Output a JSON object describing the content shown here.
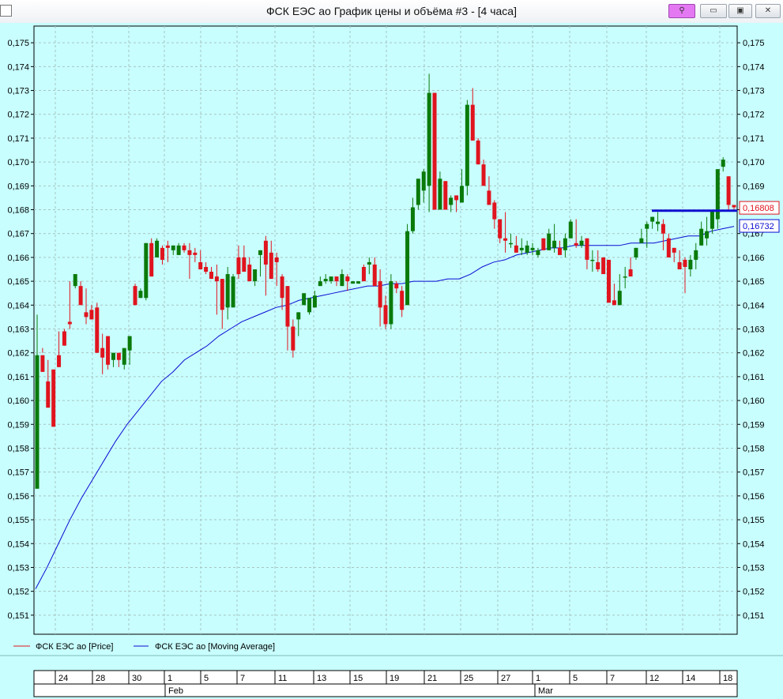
{
  "window": {
    "title": "ФСК ЕЭС ао График цены и объёма #3 - [4 часа]",
    "buttons": {
      "pin": "⚲",
      "minimize": "▭",
      "maximize": "▣",
      "close": "✕"
    }
  },
  "colors": {
    "background": "#c8fefe",
    "up": "#0a7a0a",
    "down": "#e0141e",
    "ma": "#0a0ad2",
    "grid": "#a8c4c4"
  },
  "chart_data": {
    "type": "candlestick",
    "ylim": [
      0.1502,
      0.1757
    ],
    "yticks": [
      "0,151",
      "0,152",
      "0,153",
      "0,154",
      "0,155",
      "0,156",
      "0,157",
      "0,158",
      "0,159",
      "0,160",
      "0,161",
      "0,162",
      "0,163",
      "0,164",
      "0,165",
      "0,166",
      "0,167",
      "0,168",
      "0,169",
      "0,170",
      "0,171",
      "0,172",
      "0,173",
      "0,174",
      "0,175"
    ],
    "xlabels": [
      "24",
      "28",
      "30",
      "1",
      "5",
      "7",
      "11",
      "13",
      "15",
      "19",
      "21",
      "25",
      "27",
      "1",
      "5",
      "7",
      "12",
      "14",
      "18"
    ],
    "months": [
      "Feb",
      "Mar"
    ],
    "candles": [
      [
        0.1563,
        0.1619,
        0.1565,
        0.1636
      ],
      [
        0.1619,
        0.1612,
        0.162,
        0.1622
      ],
      [
        0.1608,
        0.1597,
        0.1617,
        0.1597
      ],
      [
        0.1613,
        0.1589,
        0.1613,
        0.1589
      ],
      [
        0.1619,
        0.1614,
        0.1629,
        0.1614
      ],
      [
        0.1629,
        0.1623,
        0.163,
        0.1623
      ],
      [
        0.1633,
        0.1632,
        0.165,
        0.163
      ],
      [
        0.1648,
        0.1653,
        0.1653,
        0.1647
      ],
      [
        0.1648,
        0.164,
        0.165,
        0.164
      ],
      [
        0.1637,
        0.1635,
        0.1647,
        0.1632
      ],
      [
        0.1638,
        0.1634,
        0.164,
        0.1634
      ],
      [
        0.1639,
        0.162,
        0.1641,
        0.162
      ],
      [
        0.1622,
        0.1618,
        0.1628,
        0.1611
      ],
      [
        0.1627,
        0.1615,
        0.1627,
        0.1613
      ],
      [
        0.1617,
        0.162,
        0.162,
        0.1614
      ],
      [
        0.162,
        0.1617,
        0.162,
        0.1614
      ],
      [
        0.1615,
        0.1622,
        0.162,
        0.1613
      ],
      [
        0.1621,
        0.1627,
        0.1627,
        0.1615
      ],
      [
        0.1648,
        0.164,
        0.1649,
        0.164
      ],
      [
        0.1643,
        0.1646,
        0.1647,
        0.1643
      ],
      [
        0.1643,
        0.1666,
        0.1666,
        0.1642
      ],
      [
        0.1666,
        0.1652,
        0.1668,
        0.1652
      ],
      [
        0.166,
        0.1667,
        0.1668,
        0.166
      ],
      [
        0.1664,
        0.1659,
        0.1665,
        0.1657
      ],
      [
        0.1665,
        0.1664,
        0.1667,
        0.1658
      ],
      [
        0.1663,
        0.1665,
        0.1665,
        0.1661
      ],
      [
        0.1661,
        0.1665,
        0.1666,
        0.1661
      ],
      [
        0.1665,
        0.1663,
        0.1666,
        0.1662
      ],
      [
        0.1663,
        0.1661,
        0.1666,
        0.1651
      ],
      [
        0.1662,
        0.1661,
        0.1664,
        0.1658
      ],
      [
        0.1658,
        0.1655,
        0.1663,
        0.1655
      ],
      [
        0.1656,
        0.1654,
        0.1658,
        0.1653
      ],
      [
        0.1654,
        0.1651,
        0.1656,
        0.1651
      ],
      [
        0.1652,
        0.165,
        0.1657,
        0.1636
      ],
      [
        0.1651,
        0.1638,
        0.1651,
        0.163
      ],
      [
        0.1639,
        0.1653,
        0.1656,
        0.1634
      ],
      [
        0.1639,
        0.1652,
        0.1653,
        0.1647
      ],
      [
        0.166,
        0.1653,
        0.1665,
        0.1651
      ],
      [
        0.166,
        0.1654,
        0.1665,
        0.1654
      ],
      [
        0.1657,
        0.165,
        0.166,
        0.165
      ],
      [
        0.165,
        0.1655,
        0.1655,
        0.1648
      ],
      [
        0.1661,
        0.1663,
        0.1663,
        0.1652
      ],
      [
        0.1667,
        0.1657,
        0.1669,
        0.1644
      ],
      [
        0.1662,
        0.1651,
        0.1667,
        0.1651
      ],
      [
        0.166,
        0.1658,
        0.1662,
        0.1648
      ],
      [
        0.1652,
        0.1643,
        0.1653,
        0.1638
      ],
      [
        0.1648,
        0.1631,
        0.1648,
        0.1621
      ],
      [
        0.1631,
        0.1621,
        0.1634,
        0.1618
      ],
      [
        0.1634,
        0.1637,
        0.1637,
        0.1627
      ],
      [
        0.164,
        0.1645,
        0.164,
        0.1644
      ],
      [
        0.1637,
        0.1643,
        0.1643,
        0.1636
      ],
      [
        0.1639,
        0.1644,
        0.1646,
        0.1639
      ],
      [
        0.1648,
        0.165,
        0.1652,
        0.1648
      ],
      [
        0.165,
        0.1651,
        0.1653,
        0.1649
      ],
      [
        0.165,
        0.1652,
        0.1652,
        0.1649
      ],
      [
        0.1652,
        0.165,
        0.1652,
        0.1648
      ],
      [
        0.1648,
        0.1653,
        0.1655,
        0.1648
      ],
      [
        0.1652,
        0.165,
        0.1653,
        0.1646
      ],
      [
        0.1649,
        0.165,
        0.165,
        0.1649
      ],
      [
        0.1649,
        0.165,
        0.165,
        0.1649
      ],
      [
        0.1656,
        0.165,
        0.1657,
        0.165
      ],
      [
        0.1657,
        0.1658,
        0.166,
        0.1653
      ],
      [
        0.1657,
        0.1648,
        0.166,
        0.1648
      ],
      [
        0.165,
        0.1639,
        0.1655,
        0.1631
      ],
      [
        0.164,
        0.1632,
        0.1644,
        0.163
      ],
      [
        0.1632,
        0.165,
        0.1653,
        0.163
      ],
      [
        0.1649,
        0.1647,
        0.165,
        0.1645
      ],
      [
        0.1646,
        0.1638,
        0.1648,
        0.1635
      ],
      [
        0.164,
        0.1671,
        0.1674,
        0.164
      ],
      [
        0.1671,
        0.1681,
        0.1685,
        0.167
      ],
      [
        0.1682,
        0.1693,
        0.1693,
        0.168
      ],
      [
        0.1688,
        0.1696,
        0.1697,
        0.1683
      ],
      [
        0.169,
        0.1729,
        0.1737,
        0.1679
      ],
      [
        0.1729,
        0.168,
        0.1729,
        0.168
      ],
      [
        0.168,
        0.1693,
        0.1696,
        0.168
      ],
      [
        0.1692,
        0.168,
        0.1692,
        0.168
      ],
      [
        0.1682,
        0.1685,
        0.1686,
        0.1679
      ],
      [
        0.1686,
        0.1684,
        0.1686,
        0.1679
      ],
      [
        0.1683,
        0.169,
        0.1697,
        0.1683
      ],
      [
        0.169,
        0.1724,
        0.1726,
        0.1686
      ],
      [
        0.1724,
        0.1709,
        0.1731,
        0.1709
      ],
      [
        0.1709,
        0.1699,
        0.171,
        0.1699
      ],
      [
        0.1699,
        0.169,
        0.1701,
        0.169
      ],
      [
        0.1688,
        0.1682,
        0.1694,
        0.1682
      ],
      [
        0.1683,
        0.1676,
        0.1684,
        0.1672
      ],
      [
        0.1676,
        0.1668,
        0.1676,
        0.1666
      ],
      [
        0.1668,
        0.1667,
        0.1679,
        0.1662
      ],
      [
        0.1666,
        0.1666,
        0.167,
        0.1664
      ],
      [
        0.1665,
        0.1662,
        0.1669,
        0.1662
      ],
      [
        0.1663,
        0.1664,
        0.1668,
        0.1661
      ],
      [
        0.1662,
        0.1665,
        0.1667,
        0.1661
      ],
      [
        0.1663,
        0.1664,
        0.1666,
        0.1661
      ],
      [
        0.1661,
        0.1663,
        0.1664,
        0.166
      ],
      [
        0.1668,
        0.1663,
        0.1668,
        0.1663
      ],
      [
        0.1663,
        0.167,
        0.1672,
        0.1663
      ],
      [
        0.1664,
        0.1667,
        0.1674,
        0.1662
      ],
      [
        0.1664,
        0.1661,
        0.1667,
        0.1661
      ],
      [
        0.1663,
        0.1668,
        0.167,
        0.166
      ],
      [
        0.1668,
        0.1675,
        0.1676,
        0.1668
      ],
      [
        0.1666,
        0.1665,
        0.1676,
        0.1664
      ],
      [
        0.1665,
        0.1667,
        0.1669,
        0.1664
      ],
      [
        0.1668,
        0.1659,
        0.1668,
        0.1655
      ],
      [
        0.1659,
        0.1659,
        0.1663,
        0.1654
      ],
      [
        0.1658,
        0.1655,
        0.1663,
        0.1654
      ],
      [
        0.166,
        0.1653,
        0.166,
        0.1653
      ],
      [
        0.1659,
        0.1641,
        0.1659,
        0.1641
      ],
      [
        0.1642,
        0.164,
        0.1649,
        0.164
      ],
      [
        0.164,
        0.1646,
        0.1653,
        0.164
      ],
      [
        0.1652,
        0.1652,
        0.1656,
        0.1647
      ],
      [
        0.1655,
        0.1652,
        0.166,
        0.1652
      ],
      [
        0.166,
        0.1664,
        0.1664,
        0.1659
      ],
      [
        0.1666,
        0.1668,
        0.1672,
        0.1666
      ],
      [
        0.1672,
        0.1674,
        0.1675,
        0.1664
      ],
      [
        0.1675,
        0.1677,
        0.1677,
        0.1672
      ],
      [
        0.1674,
        0.1675,
        0.1679,
        0.1671
      ],
      [
        0.1674,
        0.167,
        0.1676,
        0.1663
      ],
      [
        0.1668,
        0.166,
        0.167,
        0.166
      ],
      [
        0.1664,
        0.1662,
        0.1664,
        0.1658
      ],
      [
        0.1658,
        0.1655,
        0.1663,
        0.1658
      ],
      [
        0.1659,
        0.1656,
        0.166,
        0.1645
      ],
      [
        0.1655,
        0.1659,
        0.1661,
        0.1652
      ],
      [
        0.1659,
        0.1663,
        0.1666,
        0.1655
      ],
      [
        0.1665,
        0.1672,
        0.1675,
        0.1665
      ],
      [
        0.1668,
        0.1671,
        0.1677,
        0.1665
      ],
      [
        0.1672,
        0.168,
        0.168,
        0.167
      ],
      [
        0.1676,
        0.1697,
        0.1697,
        0.1672
      ],
      [
        0.1698,
        0.1701,
        0.1702,
        0.1696
      ],
      [
        0.1694,
        0.1682,
        0.1694,
        0.168
      ],
      [
        0.1682,
        0.1681,
        0.1682,
        0.168
      ]
    ],
    "ma": [
      0.1521,
      0.153,
      0.154,
      0.155,
      0.1559,
      0.1567,
      0.1575,
      0.1583,
      0.159,
      0.1596,
      0.1602,
      0.1608,
      0.1612,
      0.1617,
      0.162,
      0.1623,
      0.1627,
      0.163,
      0.1633,
      0.1635,
      0.1637,
      0.1639,
      0.164,
      0.1642,
      0.1643,
      0.1644,
      0.1645,
      0.1646,
      0.1647,
      0.1648,
      0.1648,
      0.1649,
      0.1649,
      0.165,
      0.165,
      0.165,
      0.1651,
      0.1651,
      0.1653,
      0.1656,
      0.1658,
      0.1659,
      0.1661,
      0.1662,
      0.1663,
      0.1664,
      0.1664,
      0.1665,
      0.1665,
      0.1665,
      0.1665,
      0.1665,
      0.1666,
      0.1666,
      0.1666,
      0.1667,
      0.1668,
      0.1669,
      0.1669,
      0.1671,
      0.1672,
      0.1673
    ],
    "price_label": "0,16808",
    "price_value": 0.16808,
    "ma_label": "0,16732",
    "ma_value": 0.16732,
    "hline": {
      "value": 0.16796
    },
    "legend": [
      "ФСК ЕЭС ао [Price]",
      "ФСК ЕЭС ао [Moving Average]"
    ],
    "grid": true
  }
}
